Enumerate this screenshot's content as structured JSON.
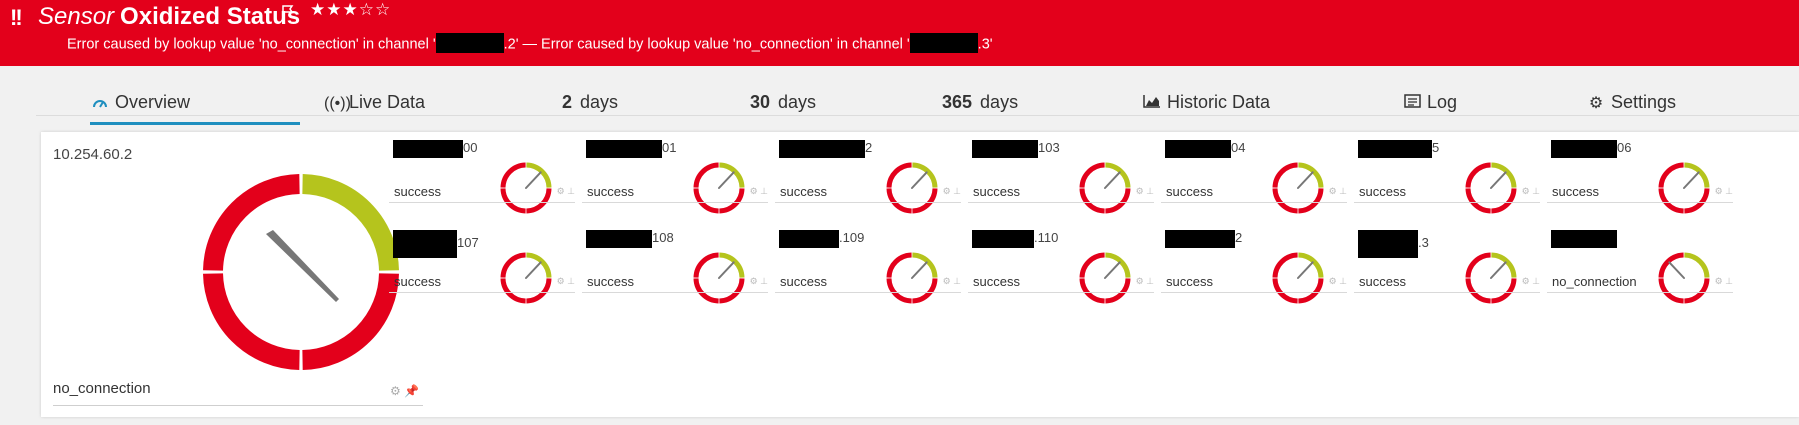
{
  "header": {
    "type_label": "Sensor",
    "name": "Oxidized Status",
    "stars": "★★★☆☆",
    "error_prefix": "Error caused by lookup value 'no_connection' in channel '",
    "error_mid": ".2' — Error caused by lookup value 'no_connection' in channel '",
    "error_suffix": ".3'",
    "colors": {
      "background": "#e3001b",
      "text": "#ffffff"
    }
  },
  "tabs": [
    {
      "icon": "gauge-icon",
      "label": "Overview",
      "active": true
    },
    {
      "icon": "live-broadcast-icon",
      "label": "Live Data"
    },
    {
      "number": "2",
      "label": "days"
    },
    {
      "number": "30",
      "label": "days"
    },
    {
      "number": "365",
      "label": "days"
    },
    {
      "icon": "area-chart-icon",
      "label": "Historic Data"
    },
    {
      "icon": "log-list-icon",
      "label": "Log"
    },
    {
      "icon": "gear-icon",
      "label": "Settings"
    }
  ],
  "main_channel": {
    "title": "10.254.60.2",
    "status": "no_connection",
    "gauge_level": 0.38
  },
  "channels": [
    {
      "label_suffix": "00",
      "status": "success"
    },
    {
      "label_suffix": "01",
      "status": "success"
    },
    {
      "label_suffix": "2",
      "status": "success"
    },
    {
      "label_suffix": "103",
      "status": "success"
    },
    {
      "label_suffix": "04",
      "status": "success"
    },
    {
      "label_suffix": "5",
      "status": "success"
    },
    {
      "label_suffix": "06",
      "status": "success"
    },
    {
      "label_suffix": "107",
      "status": "success"
    },
    {
      "label_suffix": "108",
      "status": "success"
    },
    {
      "label_suffix": ".109",
      "status": "success"
    },
    {
      "label_suffix": ".110",
      "status": "success"
    },
    {
      "label_suffix": "2",
      "status": "success"
    },
    {
      "label_suffix": ".3",
      "status": "success"
    },
    {
      "label_suffix": "",
      "status": "no_connection"
    }
  ],
  "gauge_colors": {
    "red": "#e3001b",
    "green": "#b5c41d",
    "needle": "#777777"
  }
}
